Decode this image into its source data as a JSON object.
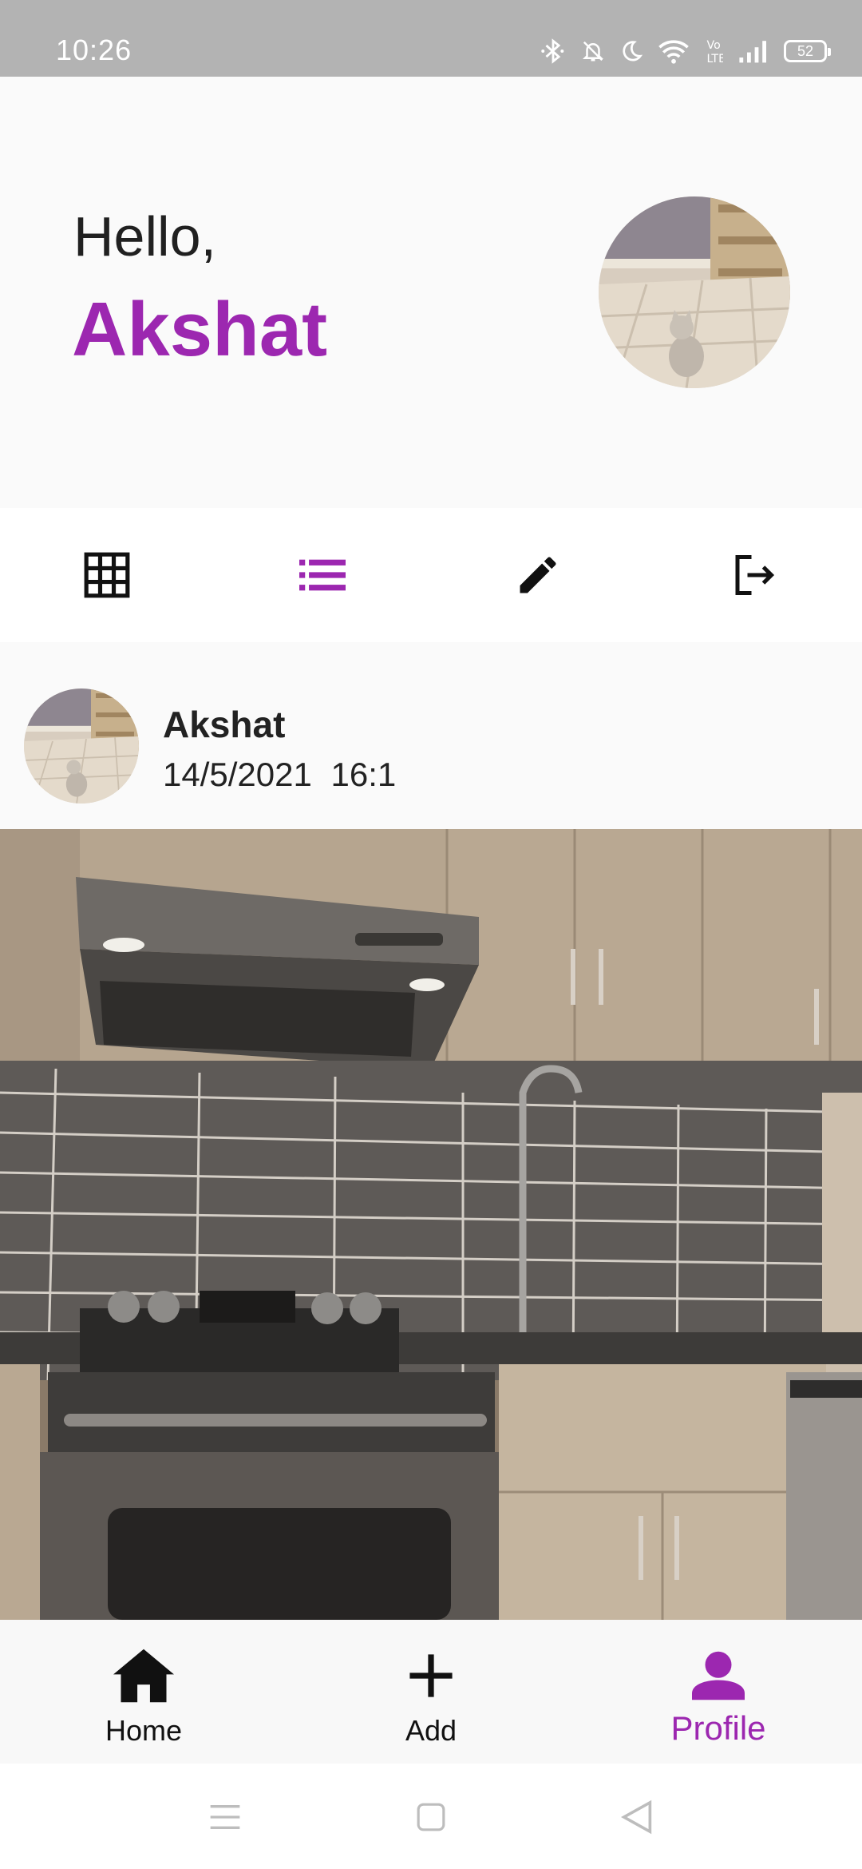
{
  "status_bar": {
    "time": "10:26",
    "battery": "52",
    "icons": [
      "bluetooth-icon",
      "mute-icon",
      "moon-icon",
      "wifi-icon",
      "volte-icon",
      "signal-icon",
      "battery-icon"
    ]
  },
  "header": {
    "greeting": "Hello,",
    "user_name": "Akshat"
  },
  "toolbar": {
    "items": [
      "grid-view-icon",
      "list-view-icon",
      "edit-icon",
      "logout-icon"
    ],
    "active": "list-view-icon"
  },
  "post": {
    "author": "Akshat",
    "timestamp": "14/5/2021  16:1"
  },
  "bottom_nav": {
    "items": [
      {
        "label": "Home",
        "icon": "home-icon"
      },
      {
        "label": "Add",
        "icon": "plus-icon"
      },
      {
        "label": "Profile",
        "icon": "person-icon"
      }
    ],
    "active": "Profile"
  },
  "colors": {
    "accent": "#9c27b0",
    "status_bar": "#b3b3b3",
    "background": "#fafafa"
  }
}
